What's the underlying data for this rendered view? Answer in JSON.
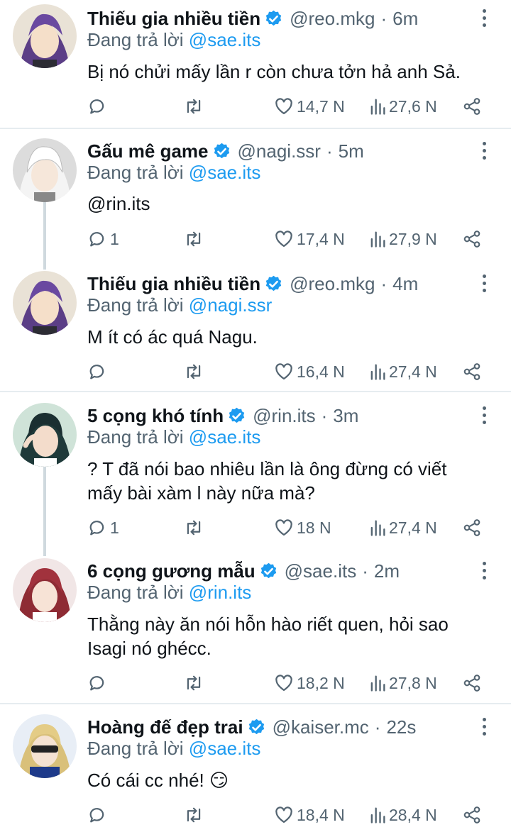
{
  "replying_prefix": "Đang trả lời",
  "tweets": [
    {
      "name": "Thiếu gia nhiều tiền",
      "handle": "@reo.mkg",
      "time": "6m",
      "reply_to": "@sae.its",
      "text": "Bị nó chửi mấy lần r còn chưa tởn hả anh Sả.",
      "mention_text": "",
      "replies": "",
      "likes": "14,7 N",
      "views": "27,6 N"
    },
    {
      "name": "Gấu mê game",
      "handle": "@nagi.ssr",
      "time": "5m",
      "reply_to": "@sae.its",
      "text": "",
      "mention_text": "@rin.its",
      "replies": "1",
      "likes": "17,4 N",
      "views": "27,9 N"
    },
    {
      "name": "Thiếu gia nhiều tiền",
      "handle": "@reo.mkg",
      "time": "4m",
      "reply_to": "@nagi.ssr",
      "text": "M ít có ác quá Nagu.",
      "mention_text": "",
      "replies": "",
      "likes": "16,4 N",
      "views": "27,4 N"
    },
    {
      "name": "5 cọng khó tính",
      "handle": "@rin.its",
      "time": "3m",
      "reply_to": "@sae.its",
      "text_line1": "? T đã nói bao nhiêu lần là ông đừng có viết",
      "text_line2": "mấy bài xàm l này nữa mà?",
      "replies": "1",
      "likes": "18 N",
      "views": "27,4 N"
    },
    {
      "name": "6 cọng gương mẫu",
      "handle": "@sae.its",
      "time": "2m",
      "reply_to": "@rin.its",
      "text_line1": "Thằng này ăn nói hỗn hào riết quen, hỏi sao",
      "text_line2": "Isagi nó ghécc.",
      "replies": "",
      "likes": "18,2 N",
      "views": "27,8 N"
    },
    {
      "name": "Hoàng đế đẹp trai",
      "handle": "@kaiser.mc",
      "time": "22s",
      "reply_to": "@sae.its",
      "text": "Có cái cc nhé! 😏",
      "replies": "",
      "likes": "18,4 N",
      "views": "28,4 N"
    }
  ],
  "icons": {
    "reply": "reply-icon",
    "retweet": "retweet-icon",
    "like": "heart-icon",
    "views": "views-icon",
    "share": "share-icon",
    "verified": "verified-badge-icon",
    "more": "more-icon"
  },
  "colors": {
    "accent": "#1d9bf0",
    "muted": "#536471",
    "text": "#0f1419",
    "divider": "#e6ecf0",
    "thread_line": "#cfd9de"
  }
}
